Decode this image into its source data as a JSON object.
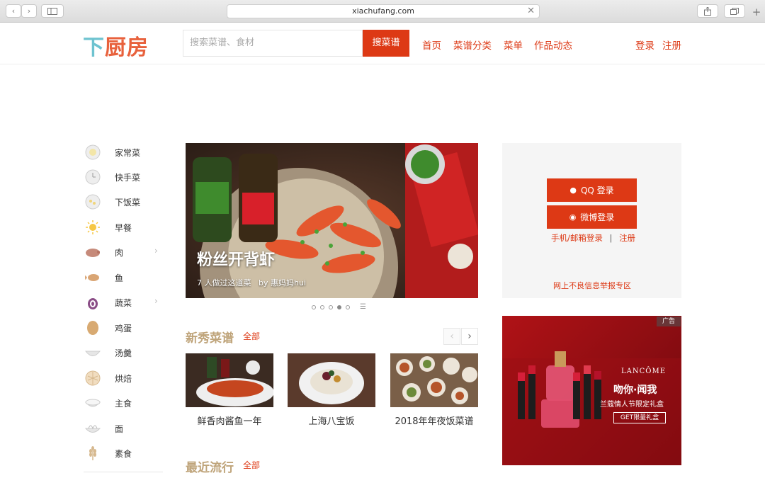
{
  "browser": {
    "url": "xiachufang.com",
    "back_icon": "chevron-left-icon",
    "forward_icon": "chevron-right-icon",
    "sidebar_icon": "sidebar-icon",
    "close_icon": "x-icon",
    "share_icon": "share-icon",
    "tabs_icon": "tabs-icon",
    "new_tab_icon": "plus-icon"
  },
  "header": {
    "logo_parts": [
      "下",
      "厨",
      "房"
    ],
    "search_placeholder": "搜索菜谱、食材",
    "search_button": "搜菜谱",
    "nav": [
      "首页",
      "菜谱分类",
      "菜单",
      "作品动态"
    ],
    "login": "登录",
    "register": "注册"
  },
  "sidebar": {
    "items": [
      {
        "label": "家常菜",
        "icon": "plate-icon",
        "arrow": false
      },
      {
        "label": "快手菜",
        "icon": "clock-icon",
        "arrow": false
      },
      {
        "label": "下饭菜",
        "icon": "rice-bowl-icon",
        "arrow": false
      },
      {
        "label": "早餐",
        "icon": "sun-icon",
        "arrow": false
      },
      {
        "label": "肉",
        "icon": "pig-icon",
        "arrow": true
      },
      {
        "label": "鱼",
        "icon": "fish-icon",
        "arrow": false
      },
      {
        "label": "蔬菜",
        "icon": "onion-icon",
        "arrow": true
      },
      {
        "label": "鸡蛋",
        "icon": "egg-icon",
        "arrow": false
      },
      {
        "label": "汤羹",
        "icon": "soup-icon",
        "arrow": false
      },
      {
        "label": "烘焙",
        "icon": "pie-icon",
        "arrow": false
      },
      {
        "label": "主食",
        "icon": "rice-icon",
        "arrow": false
      },
      {
        "label": "面",
        "icon": "noodle-icon",
        "arrow": false
      },
      {
        "label": "素食",
        "icon": "wheat-icon",
        "arrow": false
      }
    ],
    "arrow_glyph": "›"
  },
  "hero": {
    "title": "粉丝开背虾",
    "made_count": "7 人做过这道菜",
    "author": "by 惠妈妈hui",
    "dot_count": 5,
    "active_dot": 3
  },
  "new_recipes": {
    "title": "新秀菜谱",
    "all": "全部",
    "prev": "‹",
    "next": "›",
    "cards": [
      {
        "label": "鲜香肉酱鱼一年"
      },
      {
        "label": "上海八宝饭"
      },
      {
        "label": "2018年年夜饭菜谱"
      }
    ]
  },
  "trending": {
    "title": "最近流行",
    "all": "全部"
  },
  "login_box": {
    "qq": "QQ 登录",
    "weibo": "微博登录",
    "phone": "手机/邮箱登录",
    "sep": "|",
    "register": "注册",
    "report": "网上不良信息举报专区"
  },
  "ad": {
    "tag": "广告",
    "brand": "LANCÔME",
    "headline": "吻你·闻我",
    "subline": "兰蔻情人节限定礼盒",
    "cta": "GET限量礼盒",
    "colors": {
      "bg": "#a5101a",
      "accent": "#dd3915"
    }
  },
  "colors": {
    "brand": "#dd3915",
    "logo_blue": "#6ec3d0",
    "section_title": "#bfa47a"
  }
}
